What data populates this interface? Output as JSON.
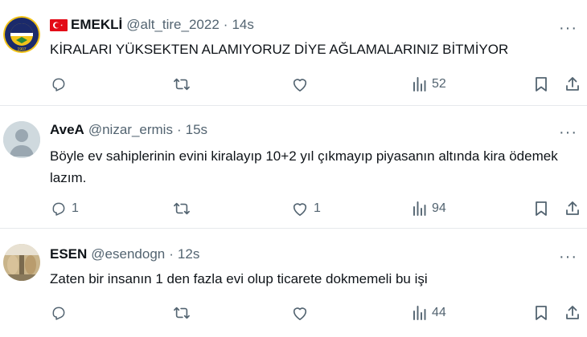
{
  "tweets": [
    {
      "name": "EMEKLİ",
      "handle": "@alt_tire_2022",
      "dot": "·",
      "time": "14s",
      "text": "KİRALARI YÜKSEKTEN ALAMIYORUZ DİYE AĞLAMALARINIZ BİTMİYOR",
      "replies": "",
      "likes": "",
      "views": "52",
      "avatar_text": "1907"
    },
    {
      "name": "AveA",
      "handle": "@nizar_ermis",
      "dot": "·",
      "time": "15s",
      "text": "Böyle ev sahiplerinin evini kiralayıp 10+2 yıl çıkmayıp piyasanın altında kira ödemek lazım.",
      "replies": "1",
      "likes": "1",
      "views": "94"
    },
    {
      "name": "ESEN",
      "handle": "@esendogn",
      "dot": "·",
      "time": "12s",
      "text": "Zaten bir insanın 1 den fazla evi olup ticarete dokmemeli bu işi",
      "replies": "",
      "likes": "",
      "views": "44"
    }
  ],
  "more_label": "···",
  "colors": {
    "muted": "#536471",
    "text": "#0f1419",
    "divider": "#e6e9ec",
    "flag_red": "#e30a17",
    "fb_navy": "#1b2a6b",
    "fb_yellow": "#f2c318"
  },
  "icons": [
    "reply-icon",
    "retweet-icon",
    "like-icon",
    "views-icon",
    "bookmark-icon",
    "share-icon",
    "more-icon",
    "turkey-flag-icon"
  ]
}
